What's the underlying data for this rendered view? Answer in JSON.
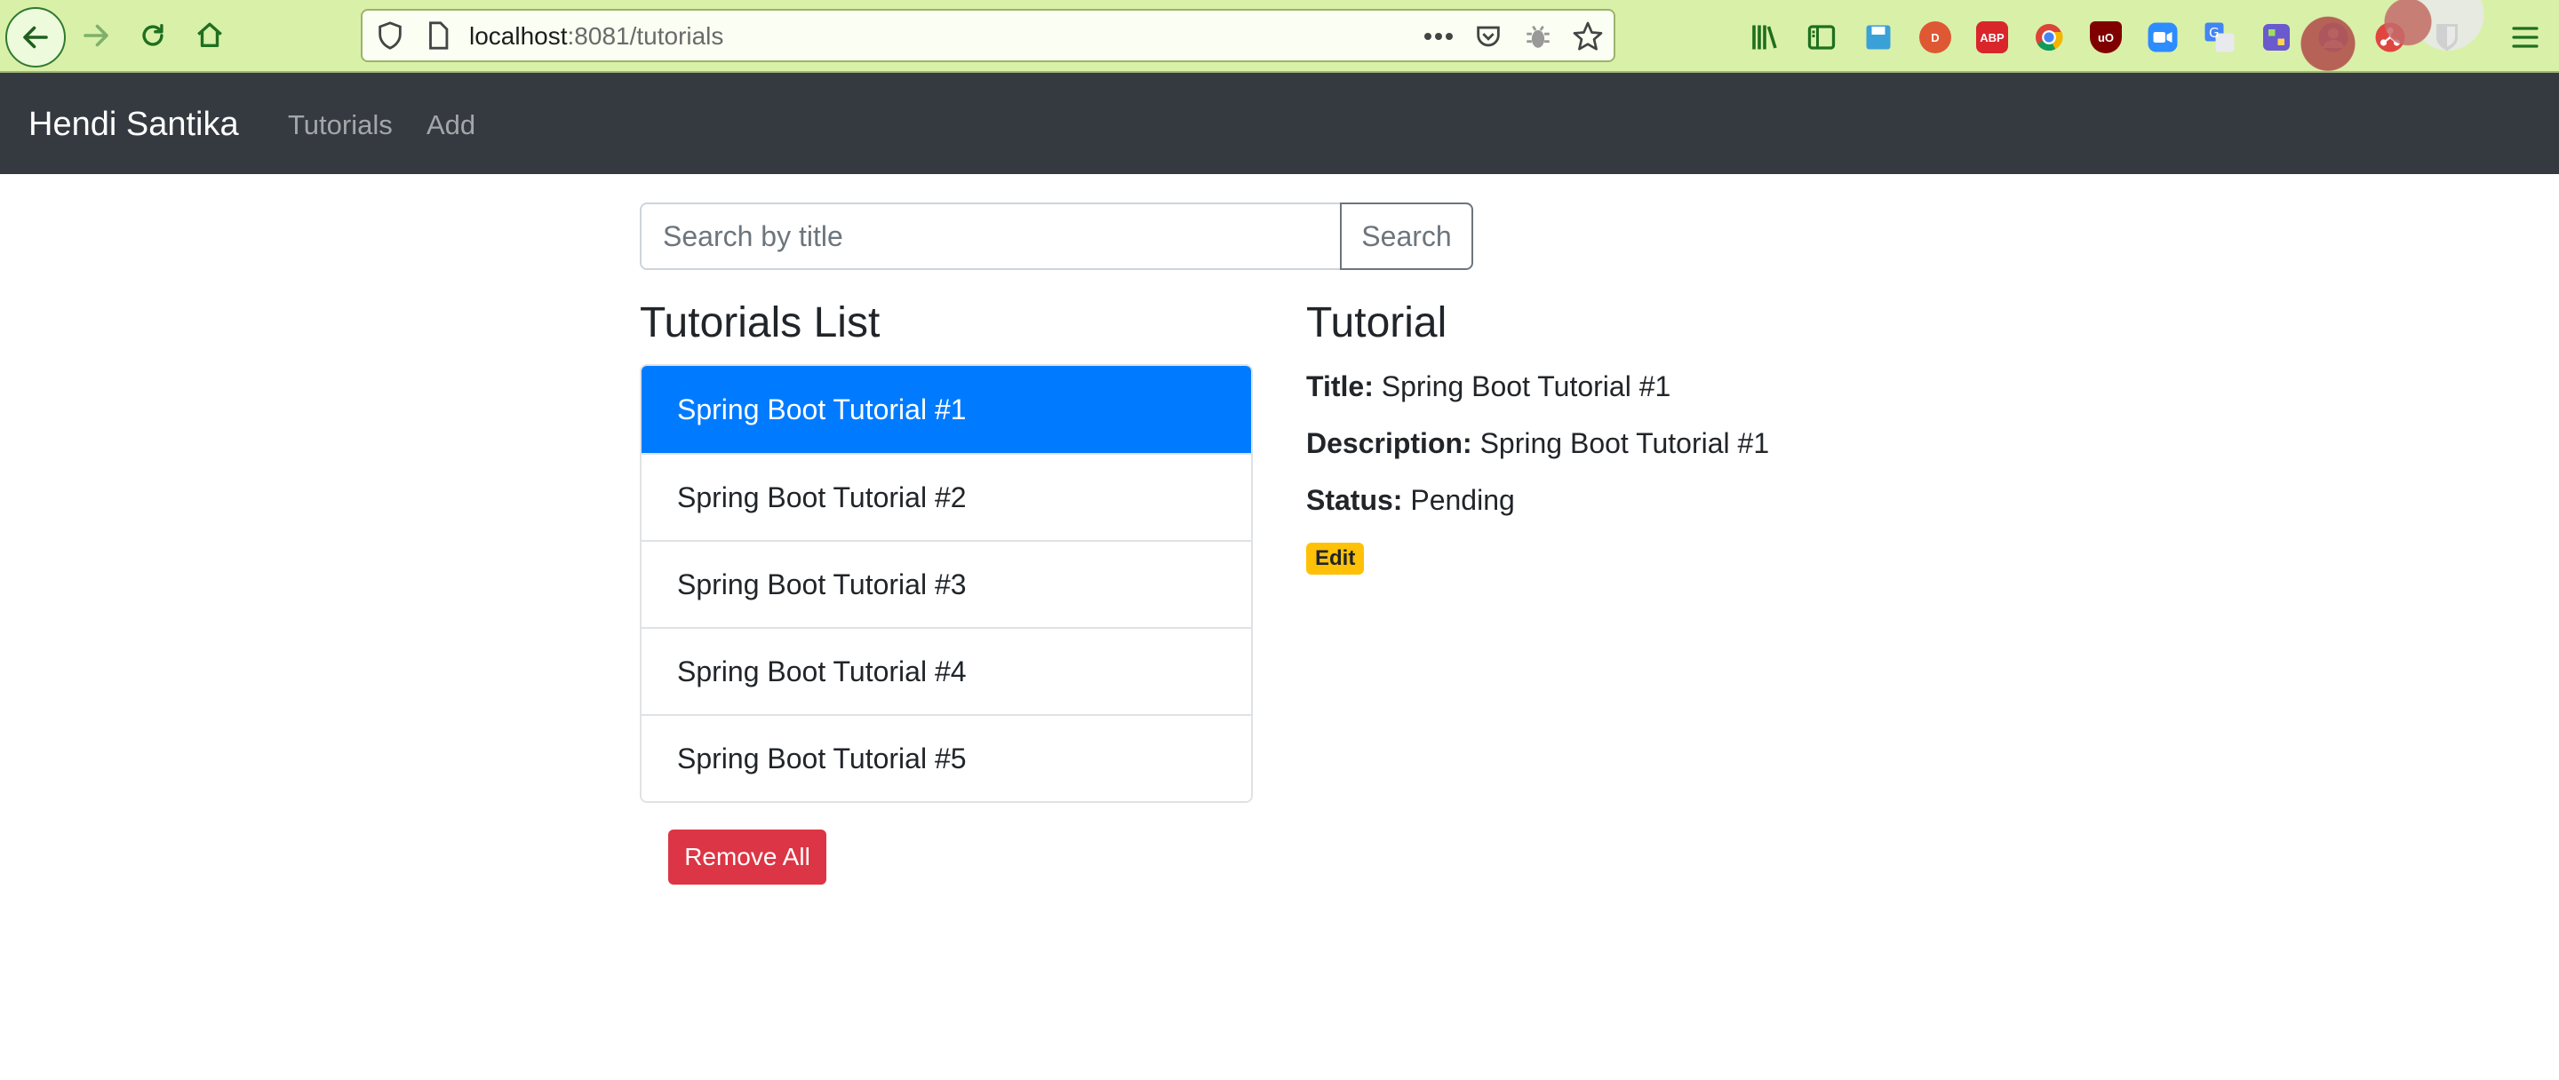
{
  "browser": {
    "url_host": "localhost",
    "url_rest": ":8081/tutorials",
    "extensions": [
      "library-icon",
      "sidebar-icon",
      "save-icon",
      "duckduckgo-icon",
      "adblock-icon",
      "chrome-icon",
      "ublock-icon",
      "zoom-icon",
      "translate-icon",
      "extension-icon",
      "avatar-icon",
      "network-icon",
      "bitwarden-icon"
    ],
    "adblock_label": "ABP",
    "ublock_label": "uO"
  },
  "navbar": {
    "brand": "Hendi Santika",
    "links": [
      "Tutorials",
      "Add"
    ]
  },
  "search": {
    "placeholder": "Search by title",
    "button_label": "Search"
  },
  "list": {
    "title": "Tutorials List",
    "items": [
      "Spring Boot Tutorial #1",
      "Spring Boot Tutorial #2",
      "Spring Boot Tutorial #3",
      "Spring Boot Tutorial #4",
      "Spring Boot Tutorial #5"
    ],
    "active_index": 0,
    "remove_all_label": "Remove All"
  },
  "detail": {
    "heading": "Tutorial",
    "title_label": "Title:",
    "title_value": "Spring Boot Tutorial #1",
    "description_label": "Description:",
    "description_value": "Spring Boot Tutorial #1",
    "status_label": "Status:",
    "status_value": "Pending",
    "edit_label": "Edit"
  },
  "colors": {
    "navbar": "#343a40",
    "primary": "#007bff",
    "danger": "#dc3545",
    "warning": "#ffc107",
    "browser_theme": "#d9f0a8"
  }
}
